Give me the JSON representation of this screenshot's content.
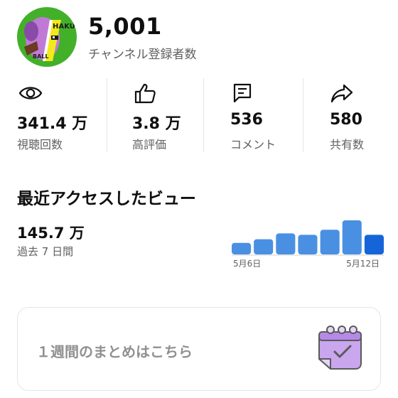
{
  "channel": {
    "avatar_text_top": "HAKUTO",
    "avatar_text_bottom": "BALL",
    "subscriber_count": "5,001",
    "subscriber_label": "チャンネル登録者数"
  },
  "stats": [
    {
      "icon": "eye-icon",
      "value": "341.4 万",
      "label": "視聴回数"
    },
    {
      "icon": "thumbs-up-icon",
      "value": "3.8 万",
      "label": "高評価"
    },
    {
      "icon": "comment-icon",
      "value": "536",
      "label": "コメント"
    },
    {
      "icon": "share-icon",
      "value": "580",
      "label": "共有数"
    }
  ],
  "recent": {
    "title": "最近アクセスしたビュー",
    "value": "145.7 万",
    "period": "過去 7 日間",
    "chart_data": {
      "type": "bar",
      "categories": [
        "5月6日",
        "",
        "",
        "",
        "",
        "",
        "5月12日"
      ],
      "values": [
        16,
        21,
        29,
        27,
        34,
        47,
        27
      ],
      "tick_labels": [
        "5月6日",
        "5月12日"
      ],
      "colors": {
        "bar": "#4a90e2",
        "last_bar": "#1565d8"
      }
    }
  },
  "summary": {
    "text": "１週間のまとめはこちら",
    "icon": "calendar-check-icon"
  }
}
